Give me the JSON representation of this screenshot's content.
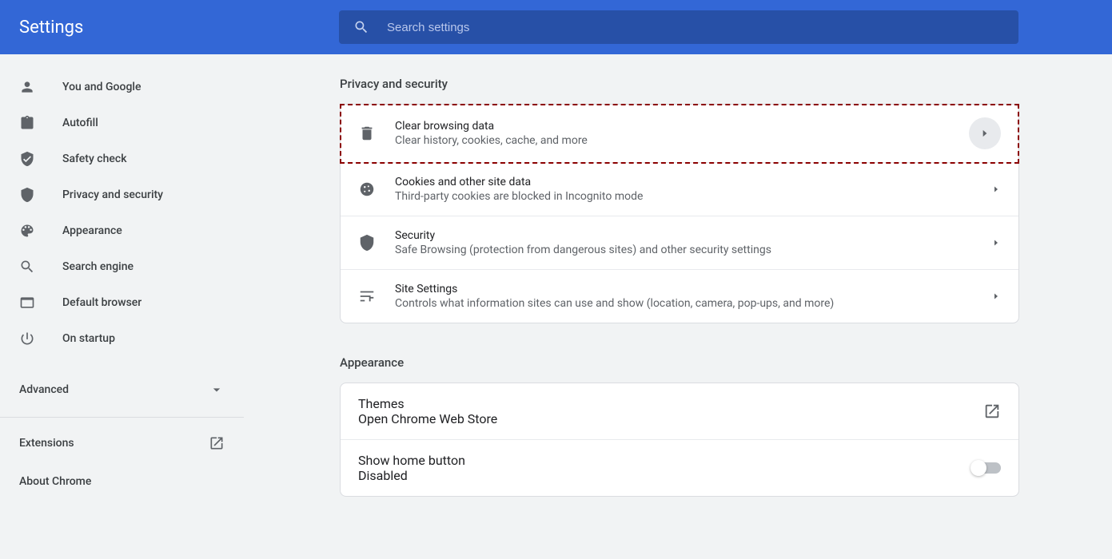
{
  "header": {
    "title": "Settings",
    "search_placeholder": "Search settings"
  },
  "sidebar": {
    "items": [
      {
        "label": "You and Google"
      },
      {
        "label": "Autofill"
      },
      {
        "label": "Safety check"
      },
      {
        "label": "Privacy and security"
      },
      {
        "label": "Appearance"
      },
      {
        "label": "Search engine"
      },
      {
        "label": "Default browser"
      },
      {
        "label": "On startup"
      }
    ],
    "advanced_label": "Advanced",
    "extensions_label": "Extensions",
    "about_label": "About Chrome"
  },
  "main": {
    "privacy": {
      "title": "Privacy and security",
      "rows": [
        {
          "title": "Clear browsing data",
          "sub": "Clear history, cookies, cache, and more"
        },
        {
          "title": "Cookies and other site data",
          "sub": "Third-party cookies are blocked in Incognito mode"
        },
        {
          "title": "Security",
          "sub": "Safe Browsing (protection from dangerous sites) and other security settings"
        },
        {
          "title": "Site Settings",
          "sub": "Controls what information sites can use and show (location, camera, pop-ups, and more)"
        }
      ]
    },
    "appearance": {
      "title": "Appearance",
      "rows": [
        {
          "title": "Themes",
          "sub": "Open Chrome Web Store"
        },
        {
          "title": "Show home button",
          "sub": "Disabled"
        }
      ]
    }
  }
}
